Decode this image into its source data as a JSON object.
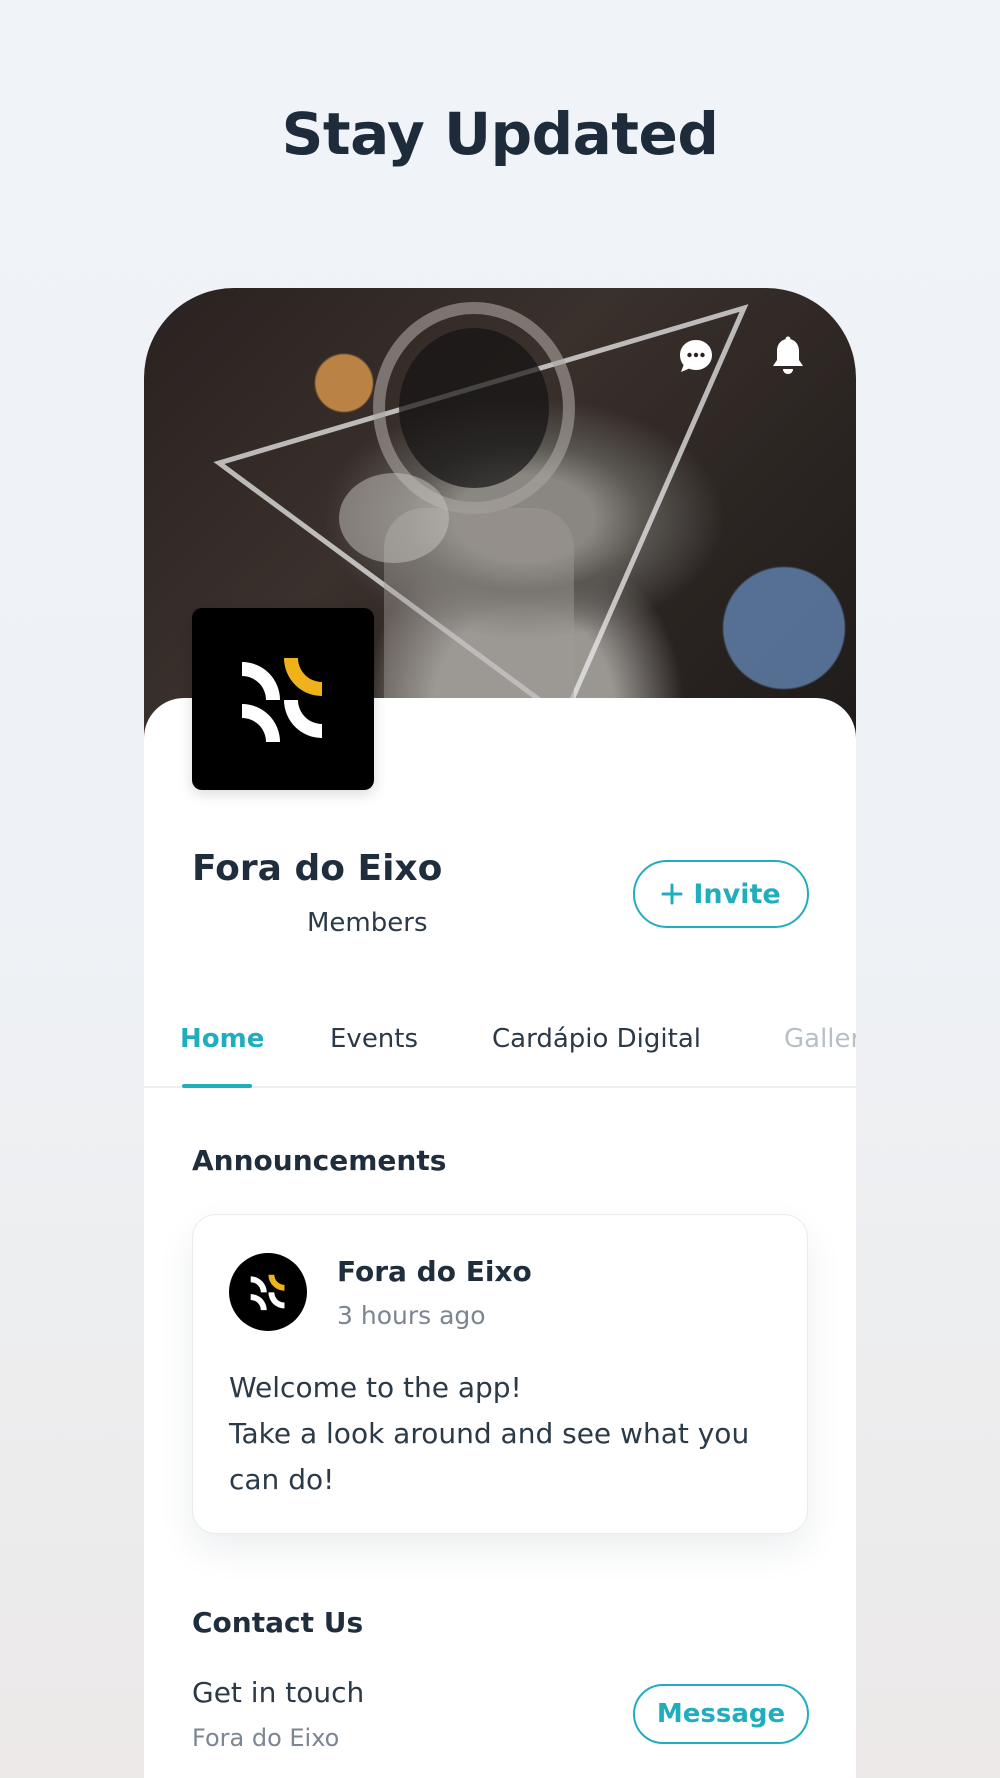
{
  "headline": "Stay Updated",
  "header": {
    "icons": [
      "chat-icon",
      "bell-icon"
    ]
  },
  "group": {
    "name": "Fora do Eixo",
    "members_label": "Members",
    "invite_label": "Invite"
  },
  "tabs": [
    {
      "label": "Home",
      "active": true
    },
    {
      "label": "Events",
      "active": false
    },
    {
      "label": "Cardápio Digital",
      "active": false
    },
    {
      "label": "Galler",
      "active": false
    }
  ],
  "announcements": {
    "title": "Announcements",
    "post": {
      "author": "Fora do Eixo",
      "time": "3 hours ago",
      "body": "Welcome to the app!\nTake a look around and see what you can do!"
    }
  },
  "contact": {
    "title": "Contact Us",
    "line1": "Get in touch",
    "line2": "Fora do Eixo",
    "button_label": "Message"
  },
  "colors": {
    "accent": "#20aebf",
    "text_dark": "#1f2d3d",
    "logo_yellow": "#f0b21a"
  }
}
